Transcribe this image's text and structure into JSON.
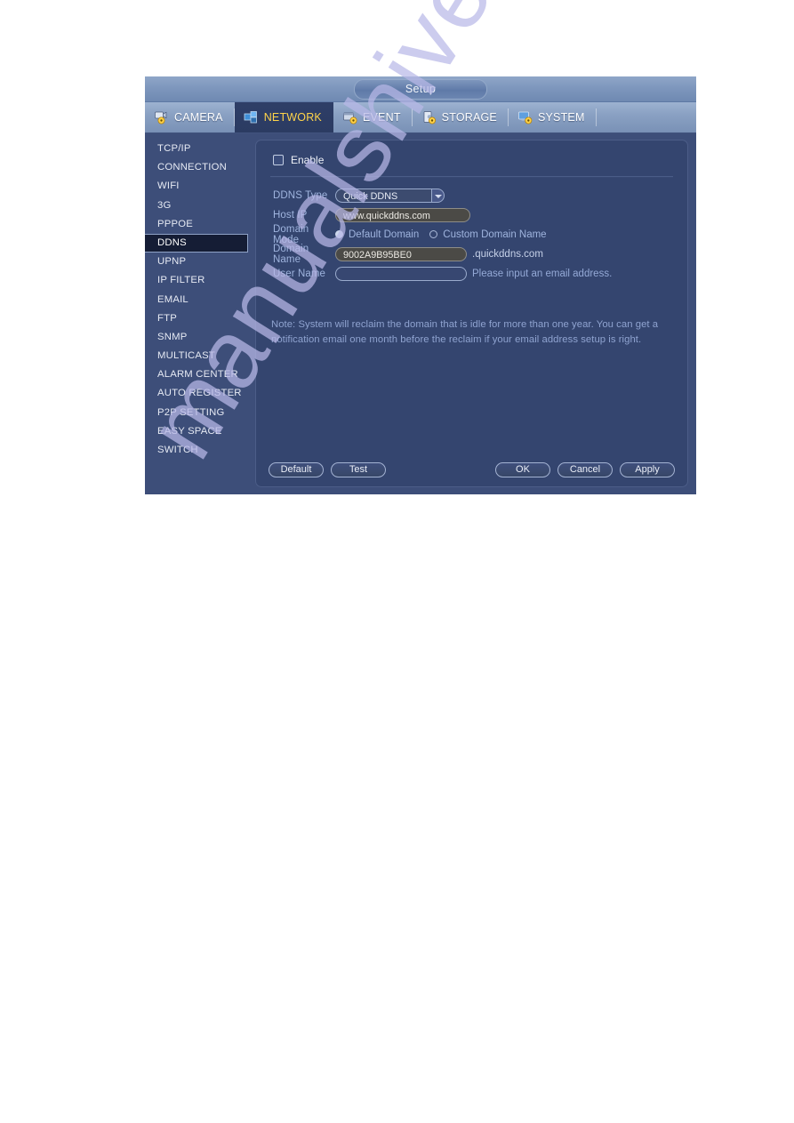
{
  "window": {
    "title": "Setup"
  },
  "tabs": [
    {
      "label": "CAMERA",
      "icon": "camera-gear-icon",
      "active": false
    },
    {
      "label": "NETWORK",
      "icon": "network-gear-icon",
      "active": true
    },
    {
      "label": "EVENT",
      "icon": "event-gear-icon",
      "active": false
    },
    {
      "label": "STORAGE",
      "icon": "storage-gear-icon",
      "active": false
    },
    {
      "label": "SYSTEM",
      "icon": "system-gear-icon",
      "active": false
    }
  ],
  "sidebar": {
    "items": [
      {
        "label": "TCP/IP",
        "active": false
      },
      {
        "label": "CONNECTION",
        "active": false
      },
      {
        "label": "WIFI",
        "active": false
      },
      {
        "label": "3G",
        "active": false
      },
      {
        "label": "PPPOE",
        "active": false
      },
      {
        "label": "DDNS",
        "active": true
      },
      {
        "label": "UPNP",
        "active": false
      },
      {
        "label": "IP FILTER",
        "active": false
      },
      {
        "label": "EMAIL",
        "active": false
      },
      {
        "label": "FTP",
        "active": false
      },
      {
        "label": "SNMP",
        "active": false
      },
      {
        "label": "MULTICAST",
        "active": false
      },
      {
        "label": "ALARM CENTER",
        "active": false
      },
      {
        "label": "AUTO REGISTER",
        "active": false
      },
      {
        "label": "P2P SETTING",
        "active": false
      },
      {
        "label": "EASY SPACE",
        "active": false
      },
      {
        "label": "SWITCH",
        "active": false
      }
    ]
  },
  "form": {
    "enable": {
      "label": "Enable",
      "checked": false
    },
    "ddns_type": {
      "label": "DDNS Type",
      "value": "Quick DDNS",
      "options": [
        "Quick DDNS"
      ]
    },
    "host_ip": {
      "label": "Host IP",
      "value": "www.quickddns.com",
      "placeholder": ""
    },
    "domain_mode": {
      "label": "Domain Mode",
      "options": [
        {
          "label": "Default Domain",
          "selected": true
        },
        {
          "label": "Custom Domain Name",
          "selected": false
        }
      ]
    },
    "domain_name": {
      "label": "Domain Name",
      "value": "9002A9B95BE0",
      "suffix": ".quickddns.com",
      "placeholder": ""
    },
    "user_name": {
      "label": "User Name",
      "value": "",
      "placeholder": "",
      "hint": "Please input an email address."
    },
    "note": "Note: System will reclaim the domain that is idle for more than one year. You can get a notification email one month before the reclaim if your email address setup is right."
  },
  "footer": {
    "default_label": "Default",
    "test_label": "Test",
    "ok_label": "OK",
    "cancel_label": "Cancel",
    "apply_label": "Apply"
  },
  "watermark": {
    "text": "manualshive.com"
  },
  "colors": {
    "window_bg": "#3d4e79",
    "panel_bg": "#34456f",
    "titlebar": "#7e97bd",
    "active_tab_text": "#ffd44a",
    "sidebar_active_bg": "#151d35",
    "label_text": "#9fb4de",
    "readonly_field_bg": "#4b4a46",
    "watermark": "#b9b9e8"
  }
}
